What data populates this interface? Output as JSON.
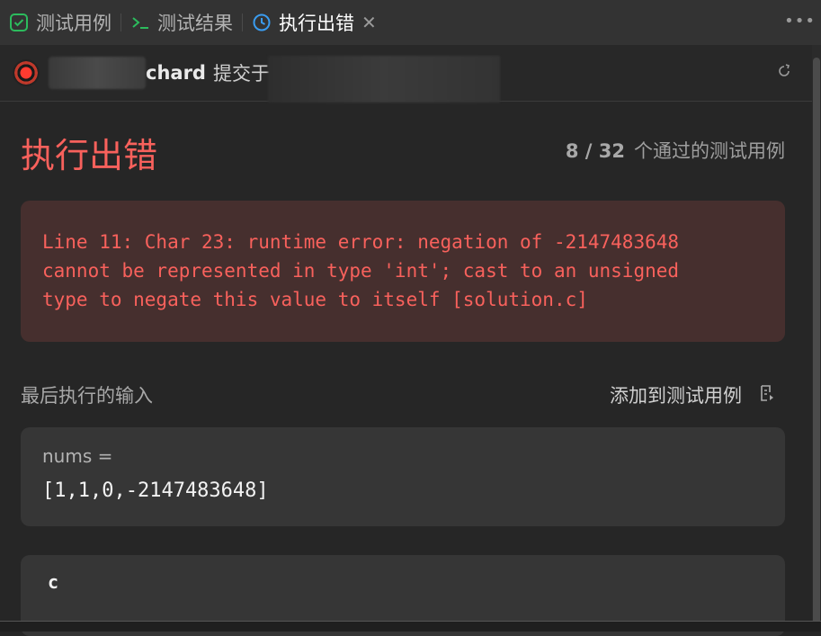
{
  "tabs": [
    {
      "label": "测试用例",
      "icon": "checkbox-icon",
      "active": false
    },
    {
      "label": "测试结果",
      "icon": "terminal-icon",
      "active": false
    },
    {
      "label": "执行出错",
      "icon": "history-icon",
      "active": true
    }
  ],
  "header": {
    "username_visible": "chard",
    "submitted_label": "提交于"
  },
  "result": {
    "title": "执行出错",
    "passed": "8 / 32",
    "passed_suffix": "个通过的测试用例",
    "error_lines": [
      "Line 11: Char 23: runtime error: negation of -2147483648",
      "cannot be represented in type 'int'; cast to an unsigned",
      "type to negate this value to itself [solution.c]"
    ]
  },
  "last_input": {
    "label": "最后执行的输入",
    "add_label": "添加到测试用例",
    "inputs": [
      {
        "name": "nums =",
        "value": "[1,1,0,-2147483648]"
      }
    ],
    "partial_next": "c"
  },
  "colors": {
    "error": "#f8615c",
    "active_icon": "#3a9cf0",
    "check_icon": "#2cbb5d"
  }
}
